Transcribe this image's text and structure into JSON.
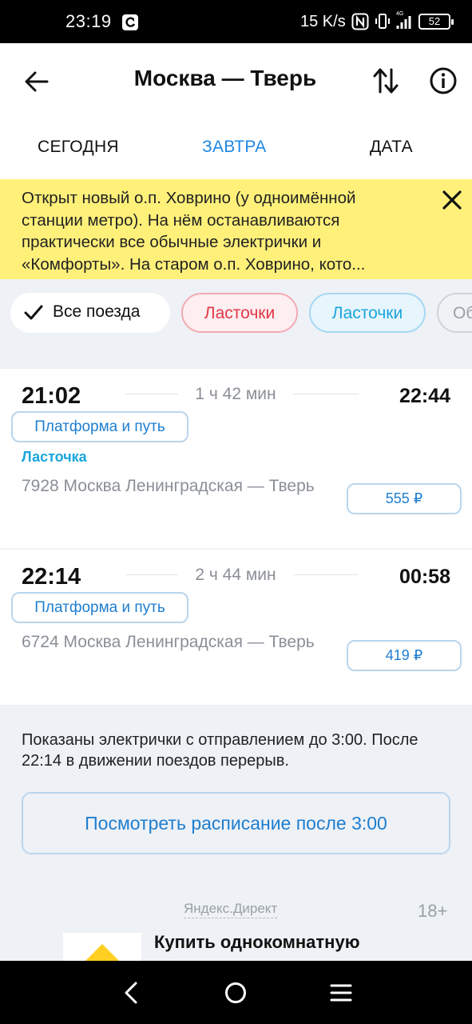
{
  "status_bar": {
    "time": "23:19",
    "speed": "15 K/s",
    "network": "4G",
    "battery": "52"
  },
  "header": {
    "title": "Москва — Тверь"
  },
  "tabs": [
    {
      "label": "СЕГОДНЯ",
      "active": false
    },
    {
      "label": "ЗАВТРА",
      "active": true
    },
    {
      "label": "ДАТА",
      "active": false
    }
  ],
  "notice": {
    "text": "Открыт новый о.п. Ховрино (у одноимённой станции метро). На нём останавливаются практически все обычные электрички и «Комфорты». На старом о.п. Ховрино, кото..."
  },
  "filters": [
    {
      "label": "Все поезда",
      "selected": true
    },
    {
      "label": "Ласточки",
      "color": "#e03748"
    },
    {
      "label": "Ласточки",
      "color": "#1aa5dd"
    },
    {
      "label": "Об"
    }
  ],
  "trains": [
    {
      "departure": "21:02",
      "duration": "1 ч  42 мин",
      "arrival": "22:44",
      "platform_label": "Платформа и путь",
      "type": "Ласточка",
      "route": "7928 Москва Ленинградская — Тверь",
      "price": "555 ₽"
    },
    {
      "departure": "22:14",
      "duration": "2 ч  44 мин",
      "arrival": "00:58",
      "platform_label": "Платформа и путь",
      "type": "",
      "route": "6724 Москва Ленинградская — Тверь",
      "price": "419 ₽"
    }
  ],
  "footer": {
    "note": "Показаны электрички с отправлением до 3:00. После 22:14 в движении поездов перерыв.",
    "more_button": "Посмотреть расписание после 3:00"
  },
  "ad": {
    "source": "Яндекс.Директ",
    "age": "18+",
    "title": "Купить однокомнатную"
  },
  "colors": {
    "accent": "#1e88e5",
    "notice_bg": "#fff07a",
    "lastochka_red": "#e03748",
    "lastochka_blue": "#1aa5dd"
  }
}
